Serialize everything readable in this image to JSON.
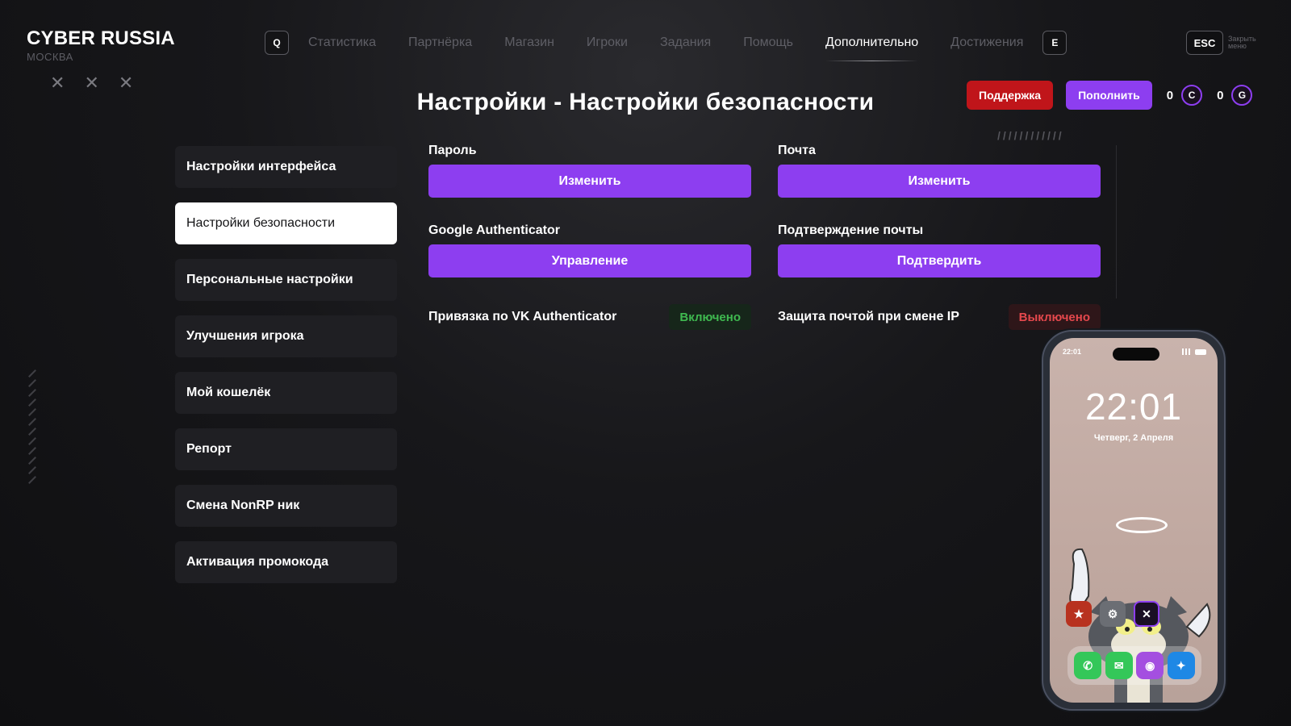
{
  "brand": {
    "title": "CYBER RUSSIA",
    "city": "МОСКВА"
  },
  "decor": {
    "crosses": [
      "✕",
      "✕",
      "✕"
    ],
    "slashes": "////////////"
  },
  "nav": {
    "left_key": "Q",
    "right_key": "E",
    "items": [
      {
        "label": "Статистика",
        "active": false
      },
      {
        "label": "Партнёрка",
        "active": false
      },
      {
        "label": "Магазин",
        "active": false
      },
      {
        "label": "Игроки",
        "active": false
      },
      {
        "label": "Задания",
        "active": false
      },
      {
        "label": "Помощь",
        "active": false
      },
      {
        "label": "Дополнительно",
        "active": true
      },
      {
        "label": "Достижения",
        "active": false
      }
    ]
  },
  "esc": {
    "key": "ESC",
    "label": "Закрыть меню"
  },
  "page_title": "Настройки - Настройки безопасности",
  "actions": {
    "support_label": "Поддержка",
    "topup_label": "Пополнить",
    "currency1": {
      "value": "0",
      "icon": "C"
    },
    "currency2": {
      "value": "0",
      "icon": "G"
    }
  },
  "sidebar": {
    "items": [
      {
        "label": "Настройки интерфейса",
        "active": false
      },
      {
        "label": "Настройки безопасности",
        "active": true
      },
      {
        "label": "Персональные настройки",
        "active": false
      },
      {
        "label": "Улучшения игрока",
        "active": false
      },
      {
        "label": "Мой кошелёк",
        "active": false
      },
      {
        "label": "Репорт",
        "active": false
      },
      {
        "label": "Смена NonRP ник",
        "active": false
      },
      {
        "label": "Активация промокода",
        "active": false
      }
    ]
  },
  "security": {
    "password": {
      "label": "Пароль",
      "button": "Изменить"
    },
    "email": {
      "label": "Почта",
      "button": "Изменить"
    },
    "google_auth": {
      "label": "Google Authenticator",
      "button": "Управление"
    },
    "email_confirm": {
      "label": "Подтверждение почты",
      "button": "Подтвердить"
    },
    "vk_auth": {
      "label": "Привязка по VK Authenticator",
      "status": "Включено"
    },
    "ip_protect": {
      "label": "Защита почтой при смене IP",
      "status": "Выключено"
    }
  },
  "phone": {
    "status_time": "22:01",
    "lock_time": "22:01",
    "lock_date": "Четверг, 2 Апреля"
  },
  "colors": {
    "accent": "#8d3ef0",
    "support": "#c0151a",
    "on": "#3fb950",
    "off": "#e5484d"
  }
}
